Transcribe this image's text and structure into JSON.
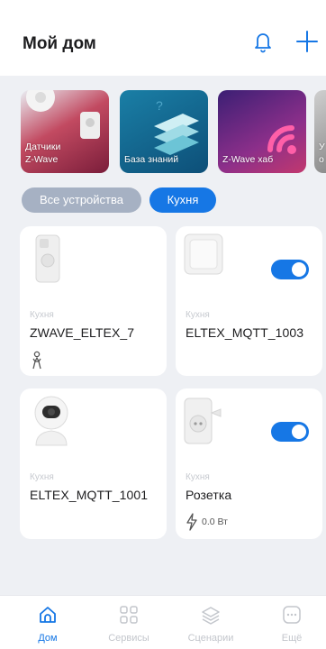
{
  "header": {
    "title": "Мой дом",
    "bell_icon": "bell-icon",
    "add_icon": "plus-icon"
  },
  "tiles": [
    {
      "label": "Датчики\nZ-Wave",
      "color": "#b5364f"
    },
    {
      "label": "База знаний",
      "color": "#0e5f8a"
    },
    {
      "label": "Z-Wave хаб",
      "color": "#5a2a8e"
    },
    {
      "label": "У\nо",
      "color": "#8a8a8a"
    }
  ],
  "filters": {
    "all": "Все устройства",
    "kitchen": "Кухня"
  },
  "devices": [
    {
      "room": "Кухня",
      "name": "ZWAVE_ELTEX_7",
      "status_icon": "motion-person-icon"
    },
    {
      "room": "Кухня",
      "name": "ELTEX_MQTT_1003",
      "toggle_on": true
    },
    {
      "room": "Кухня",
      "name": "ELTEX_MQTT_1001"
    },
    {
      "room": "Кухня",
      "name": "Розетка",
      "toggle_on": true,
      "power": "0.0 Вт",
      "power_icon": "lightning-icon"
    }
  ],
  "tabbar": [
    {
      "label": "Дом",
      "icon": "home-icon",
      "active": true
    },
    {
      "label": "Сервисы",
      "icon": "grid-icon",
      "active": false
    },
    {
      "label": "Сценарии",
      "icon": "layers-icon",
      "active": false
    },
    {
      "label": "Ещё",
      "icon": "more-icon",
      "active": false
    }
  ],
  "colors": {
    "accent": "#1677e5",
    "background": "#eef0f4"
  }
}
